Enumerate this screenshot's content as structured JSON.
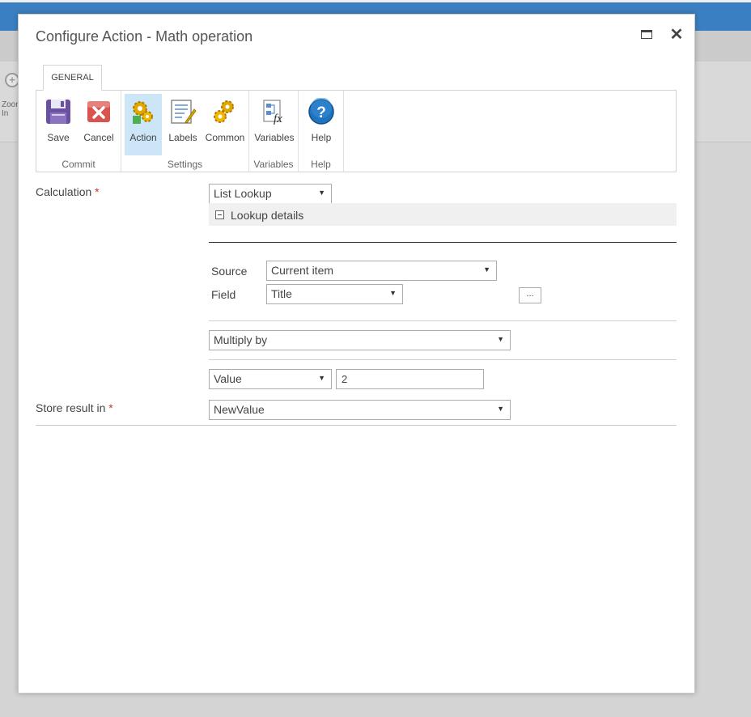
{
  "background": {
    "zoom_icon": "zoom-in-icon",
    "zoom_label": "Zoom In"
  },
  "dialog": {
    "title": "Configure Action - Math operation",
    "maximize_icon": "maximize-icon",
    "close_glyph": "✕"
  },
  "ribbon": {
    "tab": "GENERAL",
    "groups": [
      {
        "label": "Commit",
        "buttons": [
          {
            "label": "Save",
            "icon": "save-icon"
          },
          {
            "label": "Cancel",
            "icon": "cancel-icon"
          }
        ]
      },
      {
        "label": "Settings",
        "buttons": [
          {
            "label": "Action",
            "icon": "action-gears-icon",
            "active": true
          },
          {
            "label": "Labels",
            "icon": "labels-icon"
          },
          {
            "label": "Common",
            "icon": "common-gears-icon"
          }
        ]
      },
      {
        "label": "Variables",
        "buttons": [
          {
            "label": "Variables",
            "icon": "variables-fx-icon"
          }
        ]
      },
      {
        "label": "Help",
        "buttons": [
          {
            "label": "Help",
            "icon": "help-icon"
          }
        ]
      }
    ]
  },
  "form": {
    "calculation_label": "Calculation",
    "required_mark": "*",
    "calculation_value": "List Lookup",
    "lookup_details_title": "Lookup details",
    "source_label": "Source",
    "source_value": "Current item",
    "field_label": "Field",
    "field_value": "Title",
    "field_picker_label": "...",
    "operation_value": "Multiply by",
    "operand_type_value": "Value",
    "operand_value": "2",
    "store_label": "Store result in",
    "store_value": "NewValue"
  },
  "colors": {
    "accent_blue": "#3a7fc1",
    "active_button_bg": "#cde6f7",
    "required": "#c0392b"
  }
}
